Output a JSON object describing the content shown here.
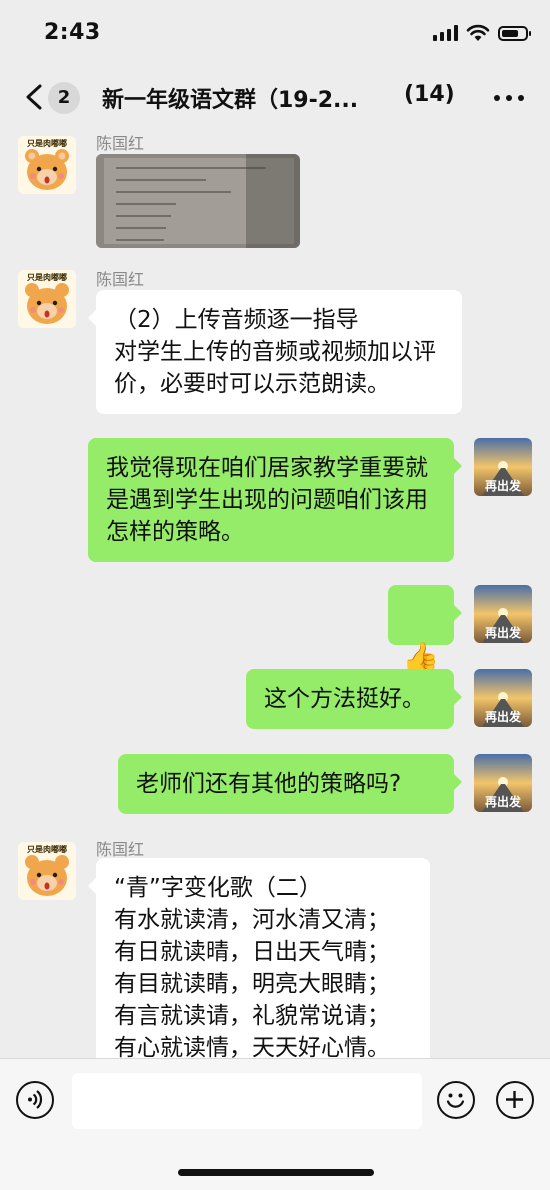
{
  "status": {
    "time": "2:43"
  },
  "nav": {
    "badge": "2",
    "title": "新一年级语文群（19-2...",
    "member_count": "(14)"
  },
  "messages": [
    {
      "id": "m1",
      "side": "left",
      "sender": "陈国红",
      "type": "image"
    },
    {
      "id": "m2",
      "side": "left",
      "sender": "陈国红",
      "type": "text",
      "text": "（2）上传音频逐一指导\n对学生上传的音频或视频加以评价，必要时可以示范朗读。"
    },
    {
      "id": "m3",
      "side": "right",
      "type": "text",
      "text": "我觉得现在咱们居家教学重要就是遇到学生出现的问题咱们该用怎样的策略。"
    },
    {
      "id": "m4",
      "side": "right",
      "type": "emoji",
      "text": "👍"
    },
    {
      "id": "m5",
      "side": "right",
      "type": "text",
      "text": "这个方法挺好。"
    },
    {
      "id": "m6",
      "side": "right",
      "type": "text",
      "text": "老师们还有其他的策略吗?"
    },
    {
      "id": "m7",
      "side": "left",
      "sender": "陈国红",
      "type": "text",
      "text": "“青”字变化歌（二）\n有水就读清，河水清又清；\n有日就读晴，日出天气晴；\n有目就读睛，明亮大眼睛；\n有言就读请，礼貌常说请；\n有心就读情，天天好心情。"
    }
  ],
  "avatars": {
    "left_icon": "cartoon-bear-avatar",
    "right_icon": "road-sunrise-avatar"
  },
  "colors": {
    "outgoing_bubble": "#95ec69",
    "incoming_bubble": "#ffffff",
    "background": "#ededed"
  }
}
